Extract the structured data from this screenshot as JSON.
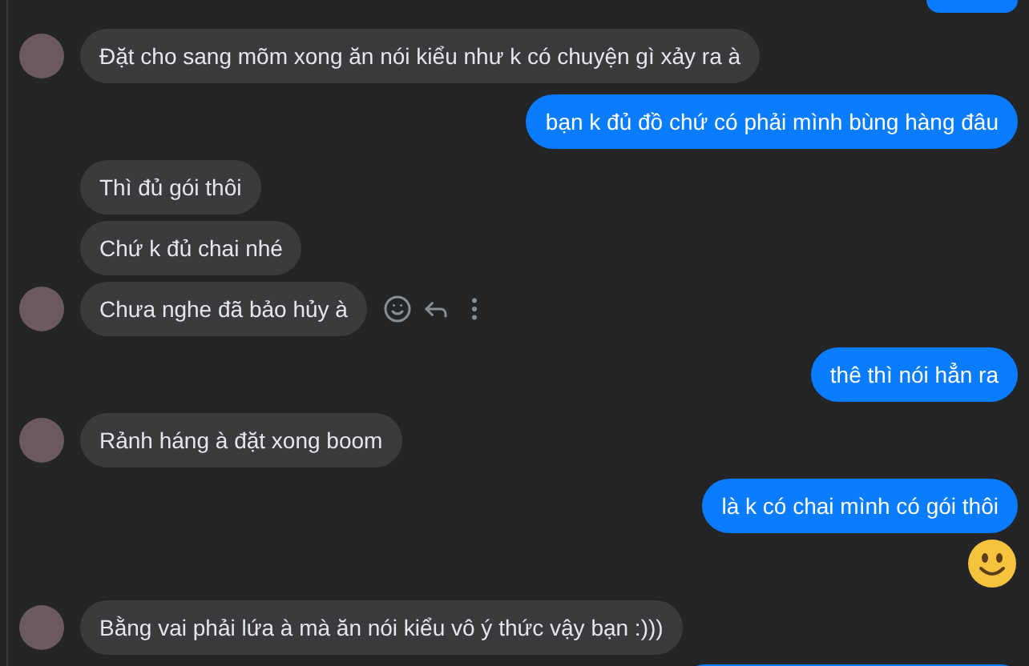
{
  "messages": [
    {
      "kind": "sent_edge_top"
    },
    {
      "kind": "received",
      "avatar": true,
      "actions": false,
      "text": "Đặt cho sang mõm xong ăn nói kiểu như k có chuyện gì xảy ra à"
    },
    {
      "kind": "sent",
      "text": "bạn k đủ đồ chứ có phải mình bùng hàng đâu"
    },
    {
      "kind": "received",
      "avatar": false,
      "actions": false,
      "text": "Thì đủ gói thôi"
    },
    {
      "kind": "received",
      "avatar": false,
      "actions": false,
      "text": "Chứ k đủ chai nhé"
    },
    {
      "kind": "received",
      "avatar": true,
      "actions": true,
      "text": "Chưa nghe đã bảo hủy à"
    },
    {
      "kind": "sent",
      "text": "thê thì nói hẳn ra"
    },
    {
      "kind": "received",
      "avatar": true,
      "actions": false,
      "text": "Rảnh háng à đặt xong boom"
    },
    {
      "kind": "sent",
      "text": "là k có chai mình có gói thôi"
    },
    {
      "kind": "sent_emoji"
    },
    {
      "kind": "received",
      "avatar": true,
      "actions": false,
      "text": "Bằng vai phải lứa à mà ăn nói kiểu vô ý thức vậy bạn :)))"
    },
    {
      "kind": "sent_edge_bottom"
    }
  ]
}
